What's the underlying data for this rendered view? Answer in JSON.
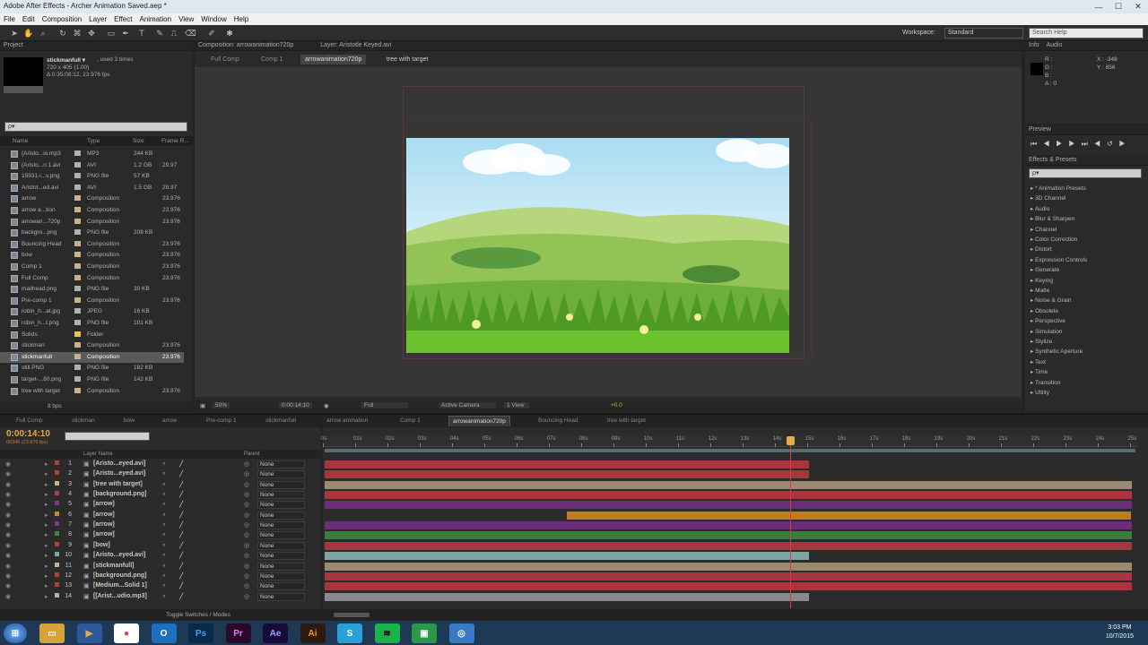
{
  "window": {
    "title": "Adobe After Effects - Archer Animation Saved.aep *",
    "controls": [
      "—",
      "☐",
      "✕"
    ]
  },
  "menu": [
    "File",
    "Edit",
    "Composition",
    "Layer",
    "Effect",
    "Animation",
    "View",
    "Window",
    "Help"
  ],
  "toolbar": {
    "workspace_label": "Workspace:",
    "workspace_value": "Standard",
    "search_placeholder": "Search Help"
  },
  "project": {
    "tab": "Project",
    "selected_name": "stickmanfull ▾",
    "used": ", used 3 times",
    "dims": "720 x 405 (1.00)",
    "duration": "Δ 0:35:08:12, 23.976 fps",
    "search": "ρ▾",
    "columns": {
      "name": "Name",
      "type": "Type",
      "size": "Size",
      "frame": "Frame R..."
    },
    "items": [
      {
        "name": "(Aristo...io.mp3",
        "type": "MP3",
        "size": "244 KB",
        "fr": "",
        "chip": "#b0b0b0"
      },
      {
        "name": "(Aristo...n 1.avi",
        "type": "AVI",
        "size": "1.2 GB",
        "fr": "29.97",
        "chip": "#b0b0b0"
      },
      {
        "name": "15931-i...v.png",
        "type": "PNG file",
        "size": "57 KB",
        "fr": "",
        "chip": "#b0b0b0"
      },
      {
        "name": "Aristot...ed.avi",
        "type": "AVI",
        "size": "1.5 GB",
        "fr": "29.97",
        "chip": "#b0b0b0"
      },
      {
        "name": "arrow",
        "type": "Composition",
        "size": "",
        "fr": "23.976",
        "chip": "#c9b289"
      },
      {
        "name": "arrow a...tion",
        "type": "Composition",
        "size": "",
        "fr": "23.976",
        "chip": "#c9b289"
      },
      {
        "name": "arrowan...720p",
        "type": "Composition",
        "size": "",
        "fr": "23.976",
        "chip": "#c9b289"
      },
      {
        "name": "backgro...png",
        "type": "PNG file",
        "size": "208 KB",
        "fr": "",
        "chip": "#b0b0b0"
      },
      {
        "name": "Bouncing Head",
        "type": "Composition",
        "size": "",
        "fr": "23.976",
        "chip": "#c9b289"
      },
      {
        "name": "bow",
        "type": "Composition",
        "size": "",
        "fr": "23.976",
        "chip": "#c9b289"
      },
      {
        "name": "Comp 1",
        "type": "Composition",
        "size": "",
        "fr": "23.976",
        "chip": "#c9b289"
      },
      {
        "name": "Full Comp",
        "type": "Composition",
        "size": "",
        "fr": "23.976",
        "chip": "#c9b289"
      },
      {
        "name": "mailhead.png",
        "type": "PNG file",
        "size": "30 KB",
        "fr": "",
        "chip": "#b0b0b0"
      },
      {
        "name": "Pre-comp 1",
        "type": "Composition",
        "size": "",
        "fr": "23.976",
        "chip": "#c9b289"
      },
      {
        "name": "robin_h...at.jpg",
        "type": "JPEG",
        "size": "16 KB",
        "fr": "",
        "chip": "#b0b0b0"
      },
      {
        "name": "robin_h...t.png",
        "type": "PNG file",
        "size": "101 KB",
        "fr": "",
        "chip": "#b0b0b0"
      },
      {
        "name": "Solids",
        "type": "Folder",
        "size": "",
        "fr": "",
        "chip": "#e5c84a"
      },
      {
        "name": "stickman",
        "type": "Composition",
        "size": "",
        "fr": "23.976",
        "chip": "#c9b289"
      },
      {
        "name": "stickmanfull",
        "type": "Composition",
        "size": "",
        "fr": "23.976",
        "chip": "#c9b289"
      },
      {
        "name": "still.PNG",
        "type": "PNG file",
        "size": "182 KB",
        "fr": "",
        "chip": "#b0b0b0"
      },
      {
        "name": "target-...80.png",
        "type": "PNG file",
        "size": "142 KB",
        "fr": "",
        "chip": "#b0b0b0"
      },
      {
        "name": "tree with target",
        "type": "Composition",
        "size": "",
        "fr": "23.976",
        "chip": "#c9b289"
      }
    ],
    "footer_bpc": "8 bpc"
  },
  "comp": {
    "tab": "Composition: arrowanimation720p",
    "layer_tab": "Layer: Aristotle Keyed.avi",
    "crumbs": [
      "Full Comp",
      "Comp 1",
      "arrowanimation720p",
      "tree with target"
    ],
    "zoom": "50%",
    "time": "0:00:14:10",
    "quality": "Full",
    "camera": "Active Camera",
    "views": "1 View",
    "exposure": "+0.0"
  },
  "info": {
    "tab": "Info",
    "tab2": "Audio",
    "r": "R :",
    "g": "G :",
    "b": "B :",
    "a": "A : 0",
    "x": "X : -348",
    "y": "Y : 856"
  },
  "preview": {
    "tab": "Preview"
  },
  "effects": {
    "tab": "Effects & Presets",
    "search": "ρ▾",
    "items": [
      "* Animation Presets",
      "3D Channel",
      "Audio",
      "Blur & Sharpen",
      "Channel",
      "Color Correction",
      "Distort",
      "Expression Controls",
      "Generate",
      "Keying",
      "Matte",
      "Noise & Grain",
      "Obsolete",
      "Perspective",
      "Simulation",
      "Stylize",
      "Synthetic Aperture",
      "Text",
      "Time",
      "Transition",
      "Utility"
    ]
  },
  "timeline_tabs": [
    "Full Comp",
    "stickman",
    "bow",
    "arrow",
    "Pre-comp 1",
    "stickmanfull",
    "arrow animation",
    "Comp 1",
    "arrowanimation720p",
    "Bouncing Head",
    "tree with target"
  ],
  "timeline": {
    "timecode": "0:00:14:10",
    "fps": "00346 (23.976 fps)",
    "col_layer": "Layer Name",
    "col_parent": "Parent",
    "ticks": [
      "0s",
      "01s",
      "02s",
      "03s",
      "04s",
      "05s",
      "06s",
      "07s",
      "08s",
      "09s",
      "10s",
      "11s",
      "12s",
      "13s",
      "14s",
      "15s",
      "16s",
      "17s",
      "18s",
      "19s",
      "20s",
      "21s",
      "22s",
      "23s",
      "24s",
      "25s"
    ],
    "current_seconds": 14.42,
    "layers": [
      {
        "num": "1",
        "name": "[Aristo...eyed.avi]",
        "parent": "None",
        "label": "#b04040",
        "bar": "#a8363c",
        "start": 0,
        "end": 15
      },
      {
        "num": "2",
        "name": "[Aristo...eyed.avi]",
        "parent": "None",
        "label": "#b04040",
        "bar": "#a8363c",
        "start": 0,
        "end": 15
      },
      {
        "num": "3",
        "name": "[tree with target]",
        "parent": "None",
        "label": "#c9b289",
        "bar": "#9a8a70",
        "start": 0,
        "end": 25
      },
      {
        "num": "4",
        "name": "[background.png]",
        "parent": "None",
        "label": "#b04040",
        "bar": "#a8363c",
        "start": 0,
        "end": 25
      },
      {
        "num": "5",
        "name": "[arrow]",
        "parent": "None",
        "label": "#7a3a8a",
        "bar": "#6a2e78",
        "start": 0,
        "end": 25
      },
      {
        "num": "6",
        "name": "[arrow]",
        "parent": "None",
        "label": "#d08a20",
        "bar": "#c07c1c",
        "start": 7.5,
        "end": 25
      },
      {
        "num": "7",
        "name": "[arrow]",
        "parent": "None",
        "label": "#7a3a8a",
        "bar": "#6a2e78",
        "start": 0,
        "end": 25
      },
      {
        "num": "8",
        "name": "[arrow]",
        "parent": "None",
        "label": "#3a8a3a",
        "bar": "#3a7c3a",
        "start": 0,
        "end": 25
      },
      {
        "num": "9",
        "name": "[bow]",
        "parent": "None",
        "label": "#b04040",
        "bar": "#a8363c",
        "start": 0,
        "end": 25
      },
      {
        "num": "10",
        "name": "[Aristo...eyed.avi]",
        "parent": "None",
        "label": "#7aa8a8",
        "bar": "#7fa4a4",
        "start": 0,
        "end": 15
      },
      {
        "num": "11",
        "name": "[stickmanfull]",
        "parent": "None",
        "label": "#c9b289",
        "bar": "#9a8a70",
        "start": 0,
        "end": 25
      },
      {
        "num": "12",
        "name": "[background.png]",
        "parent": "None",
        "label": "#b04040",
        "bar": "#a8363c",
        "start": 0,
        "end": 25
      },
      {
        "num": "13",
        "name": "[Medium...Solid 1]",
        "parent": "None",
        "label": "#b04040",
        "bar": "#a8363c",
        "start": 0,
        "end": 25
      },
      {
        "num": "14",
        "name": "[[Arist...udio.mp3]",
        "parent": "None",
        "label": "#b0b0b0",
        "bar": "#8a8a8a",
        "start": 0,
        "end": 15
      }
    ],
    "footer": "Toggle Switches / Modes"
  },
  "taskbar": {
    "icons": [
      "Explorer",
      "Media",
      "Chrome",
      "Outlook",
      "Ps",
      "Pr",
      "Ae",
      "Ai",
      "S",
      "Spotify",
      "App",
      "Orb"
    ],
    "time": "3:03 PM",
    "date": "10/7/2015"
  }
}
